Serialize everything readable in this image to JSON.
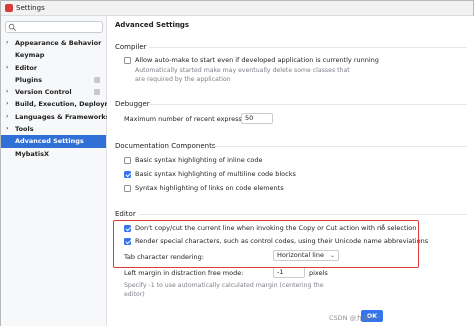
{
  "window": {
    "title": "Settings"
  },
  "sidebar": {
    "search_placeholder": "",
    "items": [
      {
        "label": "Appearance & Behavior",
        "expandable": true,
        "badge": false,
        "selected": false
      },
      {
        "label": "Keymap",
        "expandable": false,
        "badge": false,
        "selected": false
      },
      {
        "label": "Editor",
        "expandable": true,
        "badge": false,
        "selected": false
      },
      {
        "label": "Plugins",
        "expandable": false,
        "badge": true,
        "selected": false
      },
      {
        "label": "Version Control",
        "expandable": true,
        "badge": true,
        "selected": false
      },
      {
        "label": "Build, Execution, Deployment",
        "expandable": true,
        "badge": false,
        "selected": false
      },
      {
        "label": "Languages & Frameworks",
        "expandable": true,
        "badge": false,
        "selected": false
      },
      {
        "label": "Tools",
        "expandable": true,
        "badge": false,
        "selected": false
      },
      {
        "label": "Advanced Settings",
        "expandable": false,
        "badge": false,
        "selected": true
      },
      {
        "label": "MybatisX",
        "expandable": false,
        "badge": false,
        "selected": false
      }
    ]
  },
  "main": {
    "title": "Advanced Settings",
    "compiler": {
      "heading": "Compiler",
      "auto_make_label": "Allow auto-make to start even if developed application is currently running",
      "auto_make_checked": false,
      "auto_make_hint_1": "Automatically started make may eventually delete some classes that",
      "auto_make_hint_2": "are required by the application"
    },
    "debugger": {
      "heading": "Debugger",
      "max_expr_label": "Maximum number of recent expressions:",
      "max_expr_value": "50"
    },
    "documentation": {
      "heading": "Documentation Components",
      "inline_label": "Basic syntax highlighting of inline code",
      "inline_checked": false,
      "multiline_label": "Basic syntax highlighting of multiline code blocks",
      "multiline_checked": true,
      "links_label": "Syntax highlighting of links on code elements",
      "links_checked": false
    },
    "editor": {
      "heading": "Editor",
      "no_copy_label": "Don't copy/cut the current line when invoking the Copy or Cut action with no selection",
      "no_copy_checked": true,
      "render_special_label": "Render special characters, such as control codes, using their Unicode name abbreviations",
      "render_special_checked": true,
      "tab_render_label": "Tab character rendering:",
      "tab_render_value": "Horizontal line",
      "left_margin_label": "Left margin in distraction free mode:",
      "left_margin_value": "-1",
      "left_margin_unit": "pixels",
      "left_margin_hint_1": "Specify -1 to use automatically calculated margin (centering the",
      "left_margin_hint_2": "editor)"
    }
  },
  "footer": {
    "ok_label": "OK"
  },
  "watermark": "CSDN @九离十一"
}
